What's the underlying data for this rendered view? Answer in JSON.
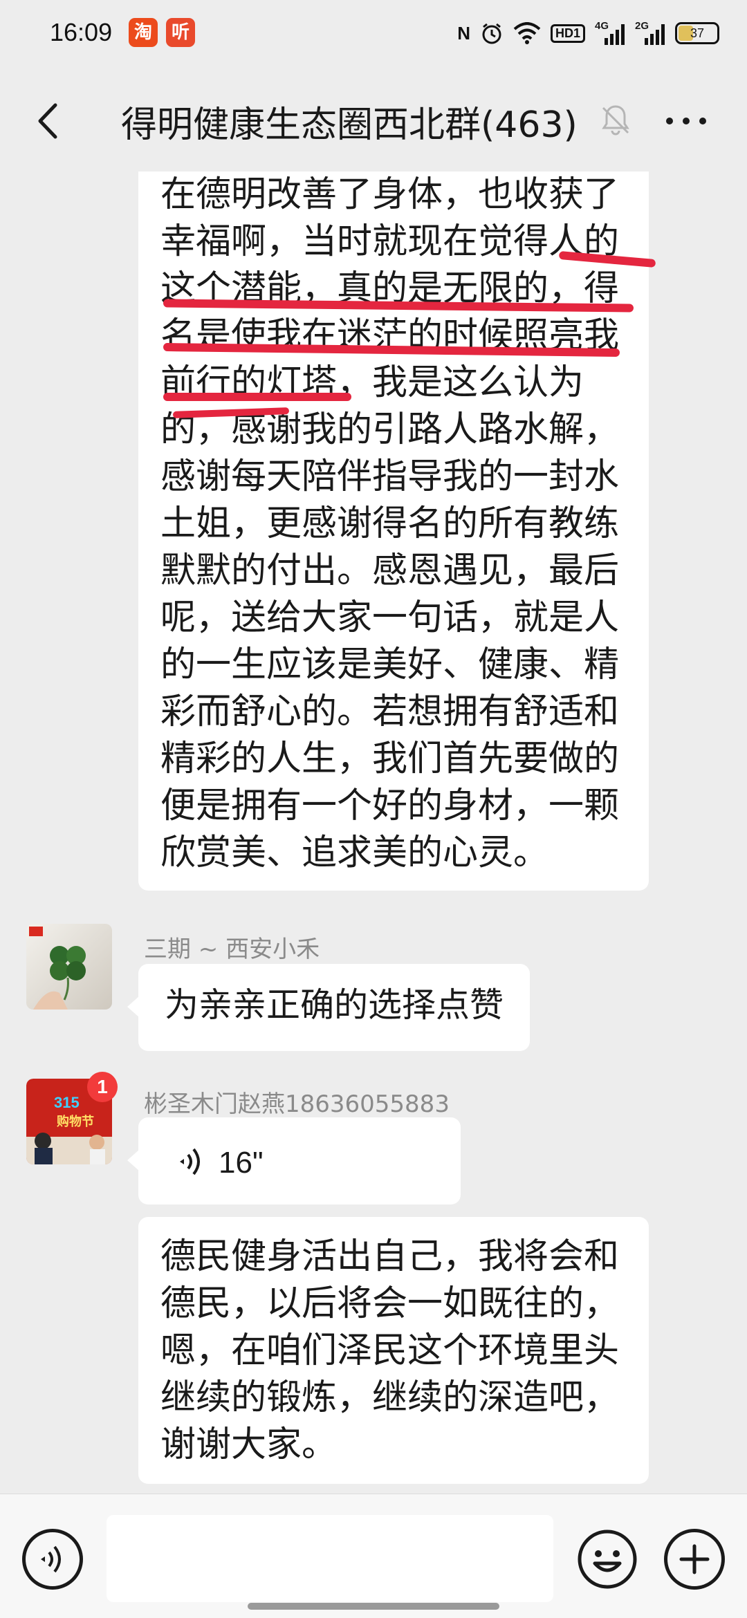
{
  "status_bar": {
    "time": "16:09",
    "apps": [
      {
        "icon": "taobao-app-icon",
        "glyph": "淘",
        "color": "#ec4b1c"
      },
      {
        "icon": "listen-app-icon",
        "glyph": "听",
        "color": "#e94a2c"
      }
    ],
    "nfc": "N",
    "hd_badge": "HD1",
    "sim1": "4G",
    "sim2": "2G",
    "battery": "37"
  },
  "header": {
    "title": "得明健康生态圈西北群(463)"
  },
  "messages": [
    {
      "type": "text",
      "text": "在德明改善了身体，也收获了\n幸福啊，当时就现在觉得人的\n这个潜能，真的是无限的，得\n名是使我在迷茫的时候照亮我\n前行的灯塔，我是这么认为\n的，感谢我的引路人路水解，\n感谢每天陪伴指导我的一封水\n土姐，更感谢得名的所有教练\n默默的付出。感恩遇见，最后\n呢，送给大家一句话，就是人\n的一生应该是美好、健康、精\n彩而舒心的。若想拥有舒适和\n精彩的人生，我们首先要做的\n便是拥有一个好的身材，一颗\n欣赏美、追求美的心灵。"
    },
    {
      "sender": "三期 ~ 西安小禾",
      "avatar": "clover-avatar",
      "type": "text",
      "text": "为亲亲正确的选择点赞"
    },
    {
      "sender": "彬圣木门赵燕18636055883",
      "avatar": "shopping-fest-avatar",
      "avatar_badge": "1",
      "avatar_banner": "315",
      "avatar_sub": "购物节",
      "type": "voice",
      "duration": "16\""
    },
    {
      "type": "text",
      "text": "德民健身活出自己，我将会和\n德民，以后将会一如既往的，\n嗯，在咱们泽民这个环境里头\n继续的锻炼，继续的深造吧，\n谢谢大家。"
    }
  ],
  "input_bar": {
    "placeholder": ""
  },
  "colors": {
    "background": "#ededed",
    "bubble": "#ffffff",
    "annotation": "#e4263f",
    "badge": "#f23b3b"
  }
}
